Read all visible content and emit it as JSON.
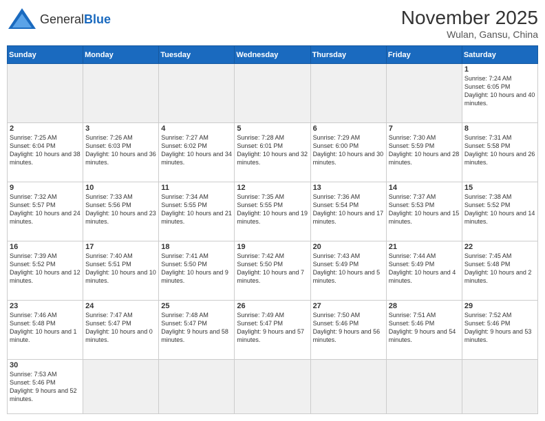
{
  "header": {
    "logo_general": "General",
    "logo_blue": "Blue",
    "month_year": "November 2025",
    "location": "Wulan, Gansu, China"
  },
  "weekdays": [
    "Sunday",
    "Monday",
    "Tuesday",
    "Wednesday",
    "Thursday",
    "Friday",
    "Saturday"
  ],
  "days": [
    {
      "date": null,
      "empty": true
    },
    {
      "date": null,
      "empty": true
    },
    {
      "date": null,
      "empty": true
    },
    {
      "date": null,
      "empty": true
    },
    {
      "date": null,
      "empty": true
    },
    {
      "date": null,
      "empty": true
    },
    {
      "date": 1,
      "sunrise": "7:24 AM",
      "sunset": "6:05 PM",
      "daylight": "10 hours and 40 minutes."
    },
    {
      "date": 2,
      "sunrise": "7:25 AM",
      "sunset": "6:04 PM",
      "daylight": "10 hours and 38 minutes."
    },
    {
      "date": 3,
      "sunrise": "7:26 AM",
      "sunset": "6:03 PM",
      "daylight": "10 hours and 36 minutes."
    },
    {
      "date": 4,
      "sunrise": "7:27 AM",
      "sunset": "6:02 PM",
      "daylight": "10 hours and 34 minutes."
    },
    {
      "date": 5,
      "sunrise": "7:28 AM",
      "sunset": "6:01 PM",
      "daylight": "10 hours and 32 minutes."
    },
    {
      "date": 6,
      "sunrise": "7:29 AM",
      "sunset": "6:00 PM",
      "daylight": "10 hours and 30 minutes."
    },
    {
      "date": 7,
      "sunrise": "7:30 AM",
      "sunset": "5:59 PM",
      "daylight": "10 hours and 28 minutes."
    },
    {
      "date": 8,
      "sunrise": "7:31 AM",
      "sunset": "5:58 PM",
      "daylight": "10 hours and 26 minutes."
    },
    {
      "date": 9,
      "sunrise": "7:32 AM",
      "sunset": "5:57 PM",
      "daylight": "10 hours and 24 minutes."
    },
    {
      "date": 10,
      "sunrise": "7:33 AM",
      "sunset": "5:56 PM",
      "daylight": "10 hours and 23 minutes."
    },
    {
      "date": 11,
      "sunrise": "7:34 AM",
      "sunset": "5:55 PM",
      "daylight": "10 hours and 21 minutes."
    },
    {
      "date": 12,
      "sunrise": "7:35 AM",
      "sunset": "5:55 PM",
      "daylight": "10 hours and 19 minutes."
    },
    {
      "date": 13,
      "sunrise": "7:36 AM",
      "sunset": "5:54 PM",
      "daylight": "10 hours and 17 minutes."
    },
    {
      "date": 14,
      "sunrise": "7:37 AM",
      "sunset": "5:53 PM",
      "daylight": "10 hours and 15 minutes."
    },
    {
      "date": 15,
      "sunrise": "7:38 AM",
      "sunset": "5:52 PM",
      "daylight": "10 hours and 14 minutes."
    },
    {
      "date": 16,
      "sunrise": "7:39 AM",
      "sunset": "5:52 PM",
      "daylight": "10 hours and 12 minutes."
    },
    {
      "date": 17,
      "sunrise": "7:40 AM",
      "sunset": "5:51 PM",
      "daylight": "10 hours and 10 minutes."
    },
    {
      "date": 18,
      "sunrise": "7:41 AM",
      "sunset": "5:50 PM",
      "daylight": "10 hours and 9 minutes."
    },
    {
      "date": 19,
      "sunrise": "7:42 AM",
      "sunset": "5:50 PM",
      "daylight": "10 hours and 7 minutes."
    },
    {
      "date": 20,
      "sunrise": "7:43 AM",
      "sunset": "5:49 PM",
      "daylight": "10 hours and 5 minutes."
    },
    {
      "date": 21,
      "sunrise": "7:44 AM",
      "sunset": "5:49 PM",
      "daylight": "10 hours and 4 minutes."
    },
    {
      "date": 22,
      "sunrise": "7:45 AM",
      "sunset": "5:48 PM",
      "daylight": "10 hours and 2 minutes."
    },
    {
      "date": 23,
      "sunrise": "7:46 AM",
      "sunset": "5:48 PM",
      "daylight": "10 hours and 1 minute."
    },
    {
      "date": 24,
      "sunrise": "7:47 AM",
      "sunset": "5:47 PM",
      "daylight": "10 hours and 0 minutes."
    },
    {
      "date": 25,
      "sunrise": "7:48 AM",
      "sunset": "5:47 PM",
      "daylight": "9 hours and 58 minutes."
    },
    {
      "date": 26,
      "sunrise": "7:49 AM",
      "sunset": "5:47 PM",
      "daylight": "9 hours and 57 minutes."
    },
    {
      "date": 27,
      "sunrise": "7:50 AM",
      "sunset": "5:46 PM",
      "daylight": "9 hours and 56 minutes."
    },
    {
      "date": 28,
      "sunrise": "7:51 AM",
      "sunset": "5:46 PM",
      "daylight": "9 hours and 54 minutes."
    },
    {
      "date": 29,
      "sunrise": "7:52 AM",
      "sunset": "5:46 PM",
      "daylight": "9 hours and 53 minutes."
    },
    {
      "date": 30,
      "sunrise": "7:53 AM",
      "sunset": "5:46 PM",
      "daylight": "9 hours and 52 minutes."
    },
    {
      "date": null,
      "empty": true
    },
    {
      "date": null,
      "empty": true
    },
    {
      "date": null,
      "empty": true
    },
    {
      "date": null,
      "empty": true
    },
    {
      "date": null,
      "empty": true
    },
    {
      "date": null,
      "empty": true
    }
  ]
}
